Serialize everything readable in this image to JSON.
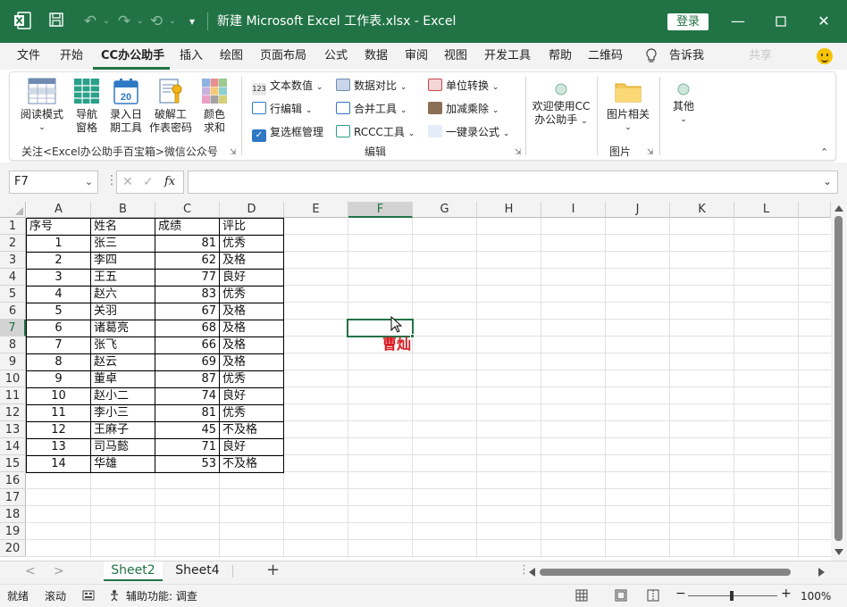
{
  "titlebar": {
    "doc_title": "新建 Microsoft Excel 工作表.xlsx  -  Excel",
    "login_label": "登录"
  },
  "menu": {
    "tabs": [
      "文件",
      "开始",
      "CC办公助手",
      "插入",
      "绘图",
      "页面布局",
      "公式",
      "数据",
      "审阅",
      "视图",
      "开发工具",
      "帮助",
      "二维码"
    ],
    "active_tab": "CC办公助手",
    "tell_me": "告诉我",
    "share": "共享"
  },
  "ribbon": {
    "group1": {
      "buttons": [
        {
          "line1": "阅读模式",
          "line2": "⌄"
        },
        {
          "line1": "导航",
          "line2": "窗格"
        },
        {
          "line1": "录入日",
          "line2": "期工具"
        },
        {
          "line1": "破解工",
          "line2": "作表密码"
        },
        {
          "line1": "颜色",
          "line2": "求和"
        }
      ],
      "label": "关注<Excel办公助手百宝箱>微信公众号"
    },
    "group2": {
      "items": [
        "文本数值",
        "数据对比",
        "单位转换",
        "行编辑",
        "合并工具",
        "加减乘除",
        "复选框管理",
        "RCCC工具",
        "一键录公式"
      ],
      "label": "编辑"
    },
    "group3": {
      "line1": "欢迎使用CC",
      "line2": "办公助手"
    },
    "group4": {
      "line1": "图片相关",
      "label": "图片"
    },
    "group5": {
      "line1": "其他"
    },
    "calendar_day": "20"
  },
  "formula_bar": {
    "name_box": "F7",
    "fx": "fx",
    "value": ""
  },
  "columns": [
    "A",
    "B",
    "C",
    "D",
    "E",
    "F",
    "G",
    "H",
    "I",
    "J",
    "K",
    "L"
  ],
  "rows": [
    "1",
    "2",
    "3",
    "4",
    "5",
    "6",
    "7",
    "8",
    "9",
    "10",
    "11",
    "12",
    "13",
    "14",
    "15",
    "16",
    "17",
    "18",
    "19",
    "20"
  ],
  "selected_cell": {
    "column": "F",
    "row": "7"
  },
  "table": {
    "headers": [
      "序号",
      "姓名",
      "成绩",
      "评比"
    ],
    "rows": [
      [
        "1",
        "张三",
        "81",
        "优秀"
      ],
      [
        "2",
        "李四",
        "62",
        "及格"
      ],
      [
        "3",
        "王五",
        "77",
        "良好"
      ],
      [
        "4",
        "赵六",
        "83",
        "优秀"
      ],
      [
        "5",
        "关羽",
        "67",
        "及格"
      ],
      [
        "6",
        "诸葛亮",
        "68",
        "及格"
      ],
      [
        "7",
        "张飞",
        "66",
        "及格"
      ],
      [
        "8",
        "赵云",
        "69",
        "及格"
      ],
      [
        "9",
        "董卓",
        "87",
        "优秀"
      ],
      [
        "10",
        "赵小二",
        "74",
        "良好"
      ],
      [
        "11",
        "李小三",
        "81",
        "优秀"
      ],
      [
        "12",
        "王麻子",
        "45",
        "不及格"
      ],
      [
        "13",
        "司马懿",
        "71",
        "良好"
      ],
      [
        "14",
        "华雄",
        "53",
        "不及格"
      ]
    ]
  },
  "overlay_text": "曹灿",
  "sheets": {
    "tabs": [
      "Sheet2",
      "Sheet4"
    ],
    "active": "Sheet2"
  },
  "status": {
    "ready": "就绪",
    "scroll": "滚动",
    "accessibility": "辅助功能: 调查",
    "zoom": "100%",
    "zoom_level": 1.0
  },
  "colors": {
    "excel_green": "#217346",
    "overlay_red": "#d71920"
  }
}
